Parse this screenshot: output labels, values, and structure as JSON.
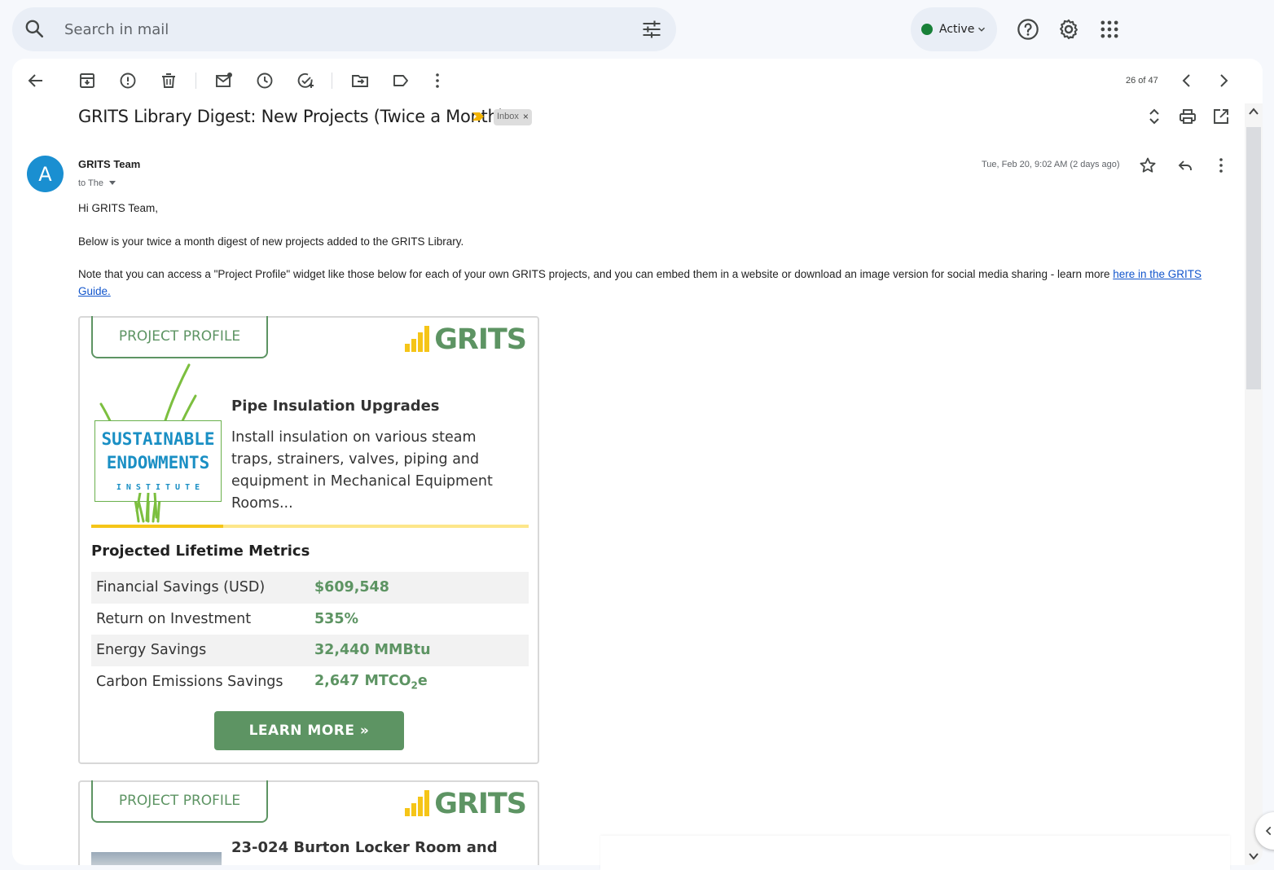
{
  "search": {
    "placeholder": "Search in mail"
  },
  "status": {
    "label": "Active",
    "color": "#188038"
  },
  "header_icons": [
    "help-icon",
    "settings-gear-icon",
    "apps-grid-icon"
  ],
  "toolbar": {
    "icons": [
      "back-arrow-icon",
      "archive-icon",
      "report-spam-icon",
      "delete-icon",
      "mark-unread-icon",
      "snooze-icon",
      "add-to-tasks-icon",
      "move-to-icon",
      "label-icon",
      "more-vert-icon"
    ],
    "pager": "26 of 47"
  },
  "email": {
    "subject": "GRITS Library Digest: New Projects (Twice a Month)",
    "label_chip": "Inbox",
    "label_chip_close": "×",
    "avatar_letter": "A",
    "sender": "GRITS Team",
    "to": "to The",
    "date": "Tue, Feb 20, 9:02 AM (2 days ago)",
    "greeting": "Hi GRITS Team,",
    "para1": "Below is your twice a month digest of new projects added to the GRITS Library.",
    "para2": "Note that you can access a \"Project Profile\" widget like those below for each of your own GRITS projects, and you can embed them in a website or download an image version for social media sharing - learn more ",
    "para2_link": "here in the GRITS Guide."
  },
  "profile1": {
    "tab": "PROJECT PROFILE",
    "logo_text": "GRITS",
    "org_line1": "SUSTAINABLE",
    "org_line2": "ENDOWMENTS",
    "org_line3": "I N S T I T U T E",
    "title": "Pipe Insulation Upgrades",
    "description": "Install insulation on various steam traps, strainers, valves, piping and equipment in Mechanical Equipment Rooms...",
    "metrics_heading": "Projected Lifetime Metrics",
    "metrics": [
      {
        "label": "Financial Savings (USD)",
        "value": "$609,548"
      },
      {
        "label": "Return on Investment",
        "value": "535%"
      },
      {
        "label": "Energy Savings",
        "value": "32,440 MMBtu"
      },
      {
        "label": "Carbon Emissions Savings",
        "value": "2,647 MTCO",
        "sub": "2",
        "suffix": "e"
      }
    ],
    "button": "LEARN MORE »"
  },
  "profile2": {
    "tab": "PROJECT PROFILE",
    "logo_text": "GRITS",
    "title": "23-024 Burton Locker Room and"
  },
  "colors": {
    "grits_green": "#5d9463",
    "grits_yellow": "#f5c518",
    "link": "#1155cc",
    "avatar": "#1a8fd1"
  }
}
